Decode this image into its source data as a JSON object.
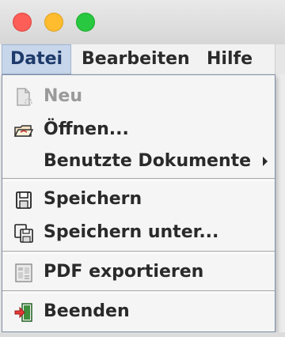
{
  "menubar": {
    "items": [
      {
        "label": "Datei"
      },
      {
        "label": "Bearbeiten"
      },
      {
        "label": "Hilfe"
      }
    ]
  },
  "menu": {
    "items": [
      {
        "label": "Neu",
        "icon": "new-document-icon",
        "enabled": false
      },
      {
        "label": "Öffnen...",
        "icon": "open-folder-icon",
        "enabled": true
      },
      {
        "label": "Benutzte Dokumente",
        "icon": "submenu-arrow-icon",
        "enabled": true
      },
      {
        "label": "Speichern",
        "icon": "save-icon",
        "enabled": true
      },
      {
        "label": "Speichern unter...",
        "icon": "save-as-icon",
        "enabled": true
      },
      {
        "label": "PDF exportieren",
        "icon": "pdf-export-icon",
        "enabled": true
      },
      {
        "label": "Beenden",
        "icon": "exit-icon",
        "enabled": true
      }
    ]
  },
  "colors": {
    "accent": "#c7d6ea",
    "close": "#fd5e57",
    "minimize": "#febc2e",
    "zoom": "#28c840"
  }
}
